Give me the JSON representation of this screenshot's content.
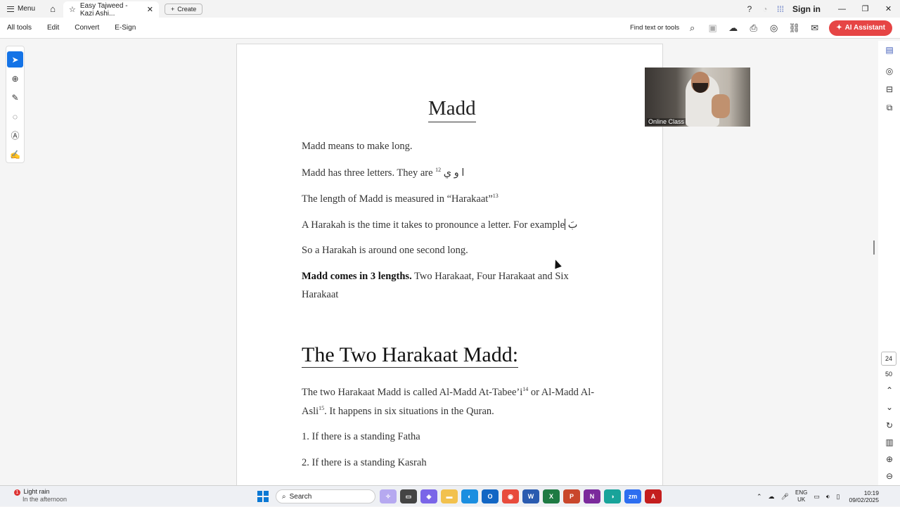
{
  "titlebar": {
    "menu_label": "Menu",
    "tab_title": "Easy Tajweed - Kazi Ashi...",
    "create_label": "Create",
    "signin_label": "Sign in",
    "icons": [
      "help-icon",
      "bell-icon",
      "apps-grid-icon"
    ]
  },
  "toolbar": {
    "items": [
      "All tools",
      "Edit",
      "Convert",
      "E-Sign"
    ],
    "find_label": "Find text or tools",
    "ai_label": "AI Assistant"
  },
  "document": {
    "heading1": "Madd",
    "p1": "Madd means to make long.",
    "p2_text": "Madd has three letters. They are",
    "p2_sup": "12",
    "p2_arabic": "ا و ي",
    "p3_text": "The length of Madd is measured in “Harakaat”",
    "p3_sup": "13",
    "p4_text": "A Harakah is the time it takes to pronounce a letter. For example",
    "p4_arabic": "بَ",
    "p5": "So a Harakah is around one second long.",
    "p6_bold": "Madd comes in 3 lengths.",
    "p6_rest": " Two Harakaat, Four Harakaat and Six",
    "p6_line2": "Harakaat",
    "heading2": "The Two Harakaat Madd:",
    "p7_a": "The two Harakaat Madd is called Al-Madd At-Tabee’i",
    "p7_sup1": "14",
    "p7_b": " or Al-Madd Al-",
    "p7_c": "Asli",
    "p7_sup2": "15",
    "p7_d": ". It happens in six situations in the Quran.",
    "item1": "1. If there is a standing Fatha",
    "item2": "2. If there is a standing Kasrah"
  },
  "video": {
    "label": "Online Class"
  },
  "pagenav": {
    "current": "24",
    "total": "50"
  },
  "taskbar": {
    "weather_title": "Light rain",
    "weather_sub": "In the afternoon",
    "weather_badge": "1",
    "search_label": "Search",
    "lang_top": "ENG",
    "lang_bottom": "UK",
    "time": "10:19",
    "date": "09/02/2025"
  },
  "colors": {
    "accent": "#1473e6",
    "ai_button": "#e64545"
  }
}
